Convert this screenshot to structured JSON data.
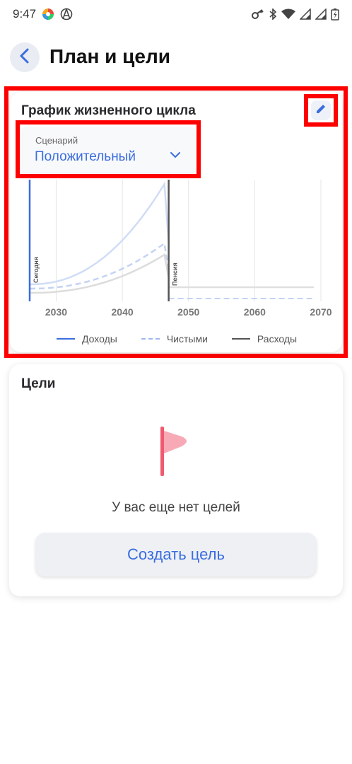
{
  "status_bar": {
    "time": "9:47"
  },
  "header": {
    "title": "План и цели"
  },
  "lifecycle": {
    "title": "График жизненного цикла",
    "scenario_label": "Сценарий",
    "scenario_value": "Положительный"
  },
  "chart_data": {
    "type": "area",
    "x_ticks": [
      "2030",
      "2040",
      "2050",
      "2060",
      "2070"
    ],
    "xlim": [
      2026,
      2070
    ],
    "markers": [
      {
        "label": "Сегодня",
        "x": 2026
      },
      {
        "label": "Пенсия",
        "x": 2047
      }
    ],
    "series": [
      {
        "name": "Доходы",
        "color": "#3b6de0",
        "style": "solid"
      },
      {
        "name": "Чистыми",
        "color": "#9fb6ee",
        "style": "dashed"
      },
      {
        "name": "Расходы",
        "color": "#555555",
        "style": "solid"
      }
    ]
  },
  "goals": {
    "title": "Цели",
    "empty_text": "У вас еще нет целей",
    "create_label": "Создать цель"
  },
  "colors": {
    "accent": "#3b6de0",
    "highlight": "#ff0000",
    "flag": "#ef5a6f"
  }
}
